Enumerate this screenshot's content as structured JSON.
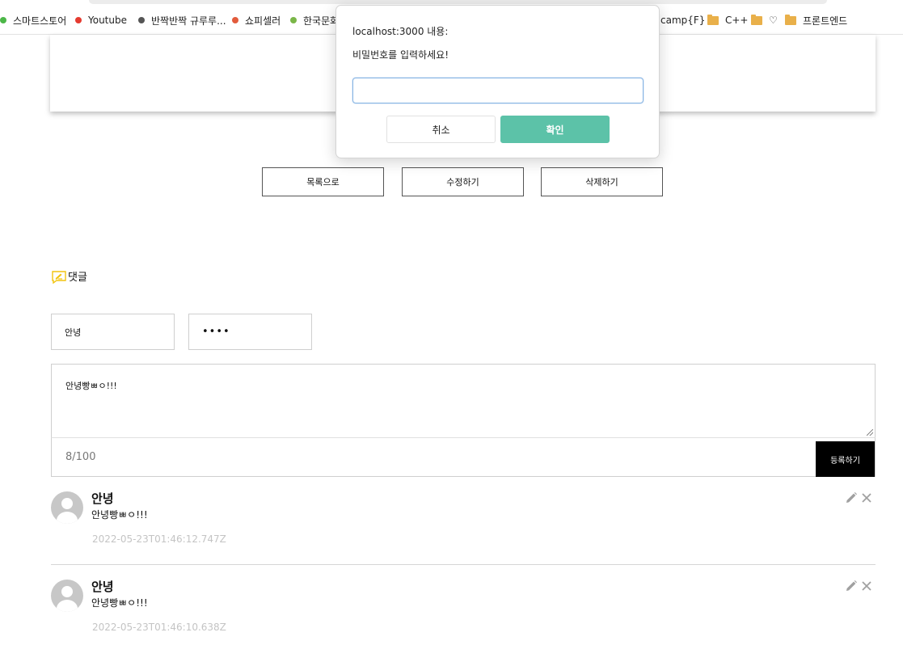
{
  "bookmarks": [
    {
      "label": "스마트스토어",
      "icon": "green-dot-icon",
      "color": "#4cb748"
    },
    {
      "label": "Youtube",
      "icon": "red-dot-icon",
      "color": "#e53b30"
    },
    {
      "label": "반짝반짝 규루루...",
      "icon": "dark-dot-icon",
      "color": "#555555"
    },
    {
      "label": "쇼피셀러",
      "icon": "orange-dot-icon",
      "color": "#e25b3c"
    },
    {
      "label": "한국문화",
      "icon": "green-dot-icon",
      "color": "#7ab648"
    },
    {
      "label": "camp{F}",
      "icon": "none"
    },
    {
      "label": "C++",
      "icon": "folder-icon"
    },
    {
      "label": "♡",
      "icon": "folder-icon"
    },
    {
      "label": "프론트엔드",
      "icon": "folder-icon"
    }
  ],
  "actions": {
    "list_label": "목록으로",
    "edit_label": "수정하기",
    "delete_label": "삭제하기"
  },
  "comments_section": {
    "title": "댓글",
    "icon": "comment-pencil-icon",
    "writer_value": "안녕",
    "password_value": "••••",
    "content_value": "안녕빵ㅃㅇ!!!",
    "counter": "8/100",
    "submit_label": "등록하기"
  },
  "comments": [
    {
      "writer": "안녕",
      "content": "안녕빵ㅃㅇ!!!",
      "date": "2022-05-23T01:46:12.747Z"
    },
    {
      "writer": "안녕",
      "content": "안녕빵ㅃㅇ!!!",
      "date": "2022-05-23T01:46:10.638Z"
    }
  ],
  "dialog": {
    "title": "localhost:3000 내용:",
    "message": "비밀번호를 입력하세요!",
    "input_value": "",
    "cancel_label": "취소",
    "ok_label": "확인",
    "ok_color": "#5cc2a8"
  }
}
